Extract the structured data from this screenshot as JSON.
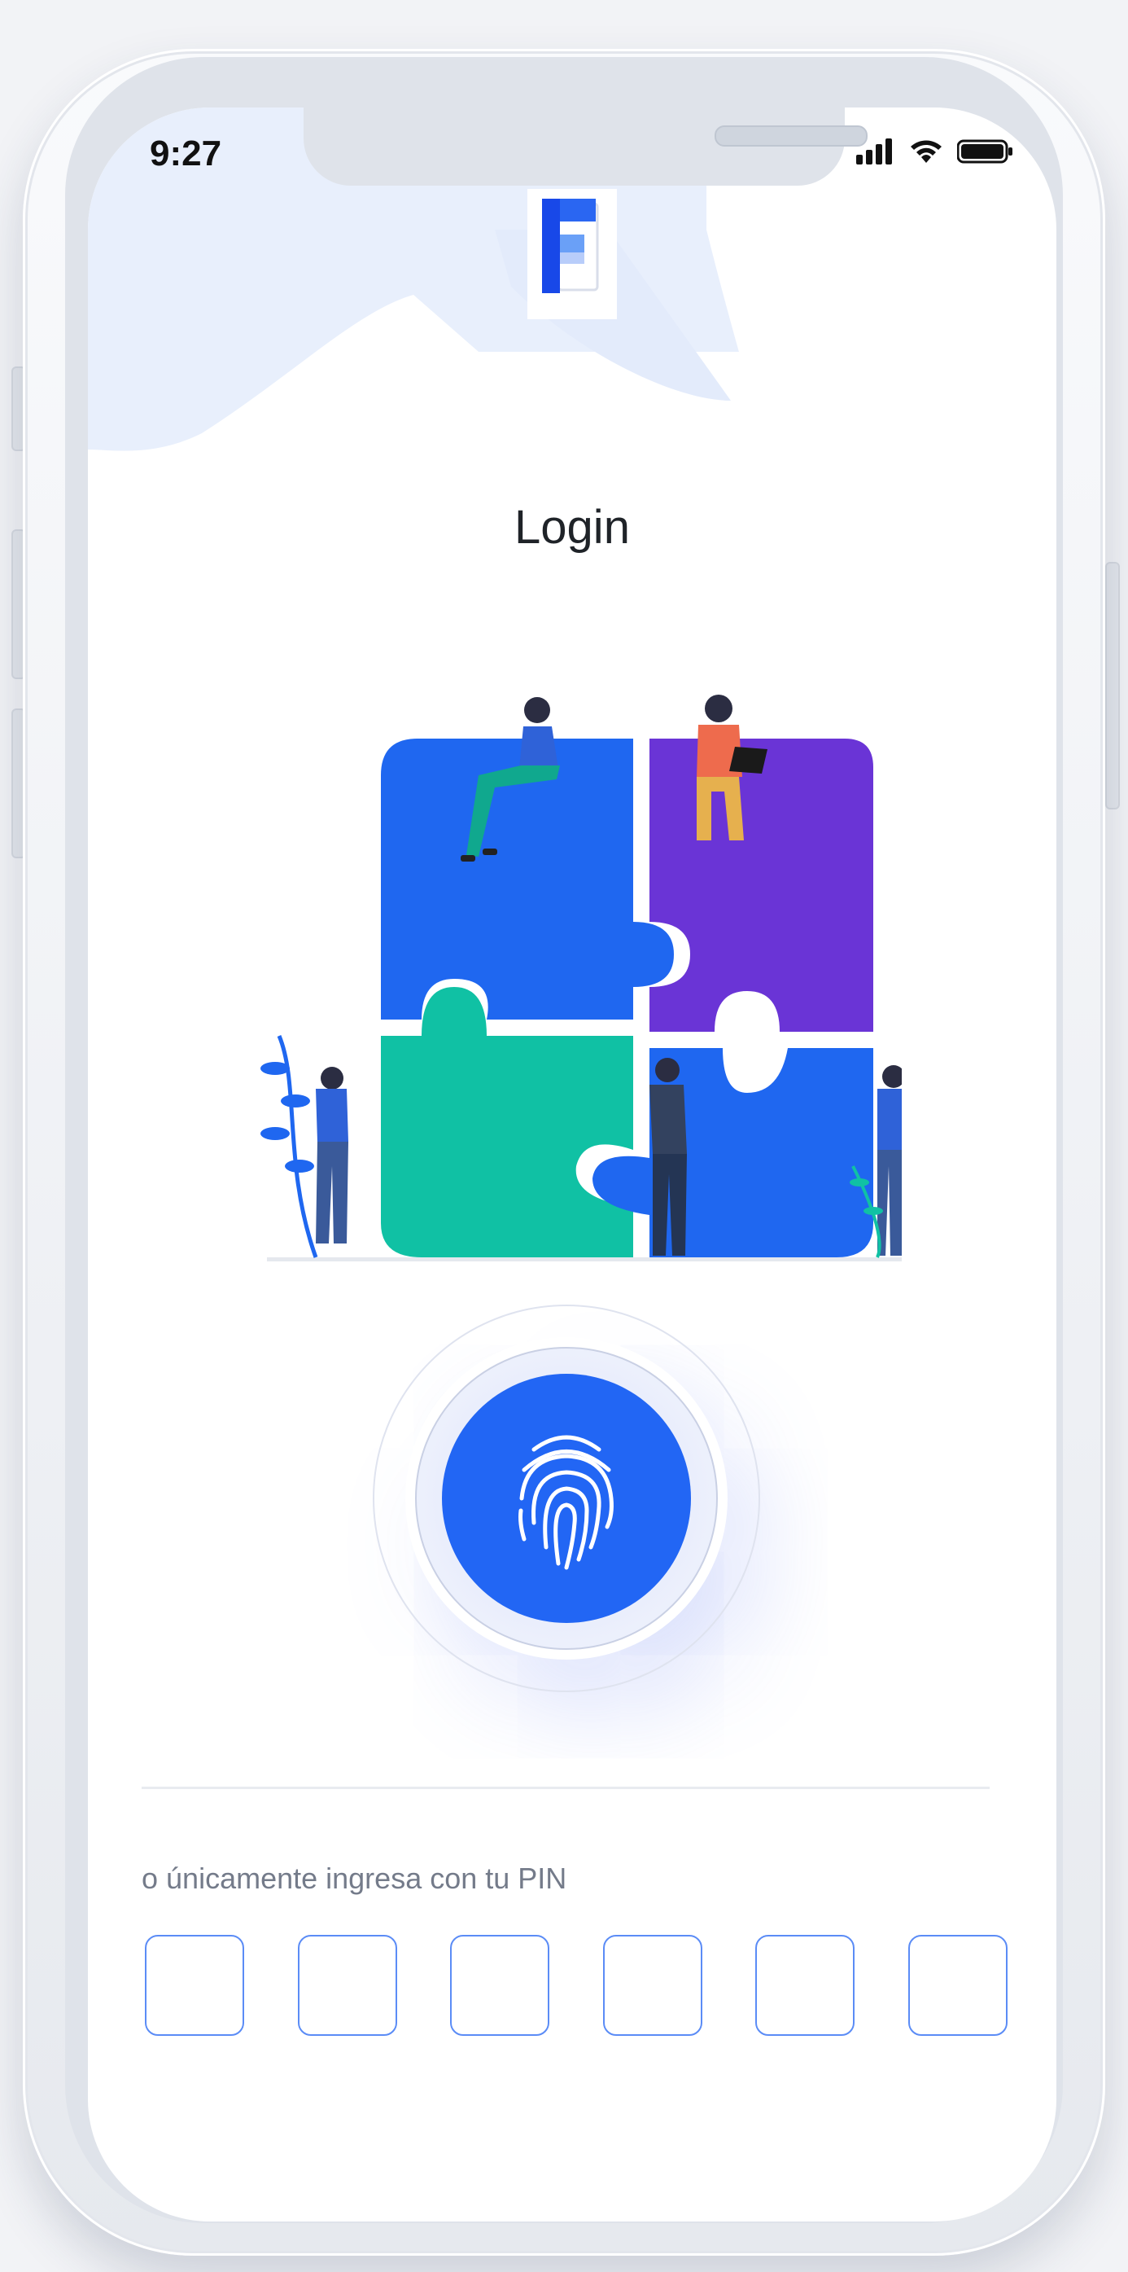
{
  "status_bar": {
    "time": "9:27"
  },
  "app": {
    "logo_icon": "app-logo-F"
  },
  "login": {
    "title": "Login",
    "fingerprint_icon": "fingerprint-icon",
    "pin_prompt": "o únicamente ingresa con tu PIN",
    "pin_values": [
      "",
      "",
      "",
      "",
      "",
      ""
    ]
  },
  "colors": {
    "accent": "#2266f4",
    "pin_border": "#5b8cf6",
    "blob": "#e8effc",
    "puzzle_blue": "#1f67f0",
    "puzzle_purple": "#6a34d6",
    "puzzle_teal": "#10c1a4"
  }
}
